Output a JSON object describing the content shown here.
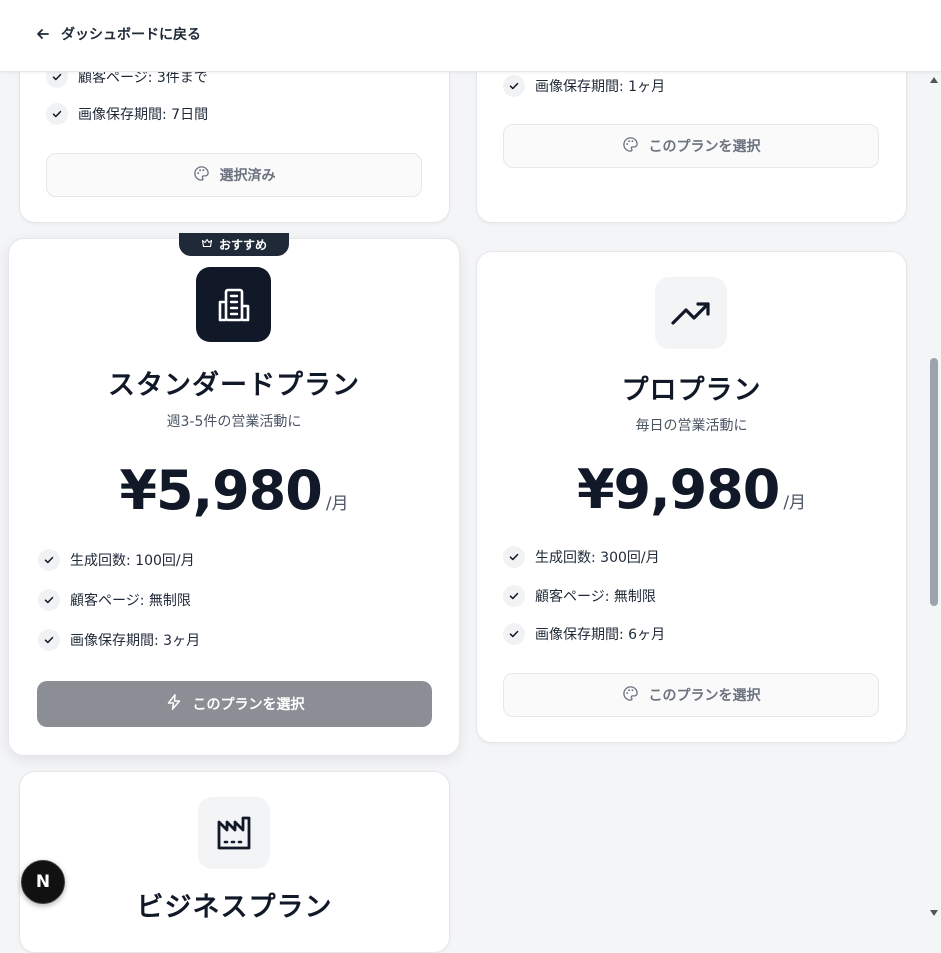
{
  "header": {
    "back_label": "ダッシュボードに戻る"
  },
  "cards": {
    "top_left": {
      "features": [
        "顧客ページ: 3件まで",
        "画像保存期間: 7日間"
      ],
      "button_label": "選択済み"
    },
    "top_right": {
      "features": [
        "画像保存期間: 1ヶ月"
      ],
      "button_label": "このプランを選択"
    },
    "standard": {
      "badge": "おすすめ",
      "name": "スタンダードプラン",
      "desc": "週3-5件の営業活動に",
      "price": "¥5,980",
      "per": "/月",
      "features": [
        "生成回数: 100回/月",
        "顧客ページ: 無制限",
        "画像保存期間: 3ヶ月"
      ],
      "button_label": "このプランを選択"
    },
    "pro": {
      "name": "プロプラン",
      "desc": "毎日の営業活動に",
      "price": "¥9,980",
      "per": "/月",
      "features": [
        "生成回数: 300回/月",
        "顧客ページ: 無制限",
        "画像保存期間: 6ヶ月"
      ],
      "button_label": "このプランを選択"
    },
    "business": {
      "name": "ビジネスプラン"
    }
  },
  "fab_label": "N"
}
